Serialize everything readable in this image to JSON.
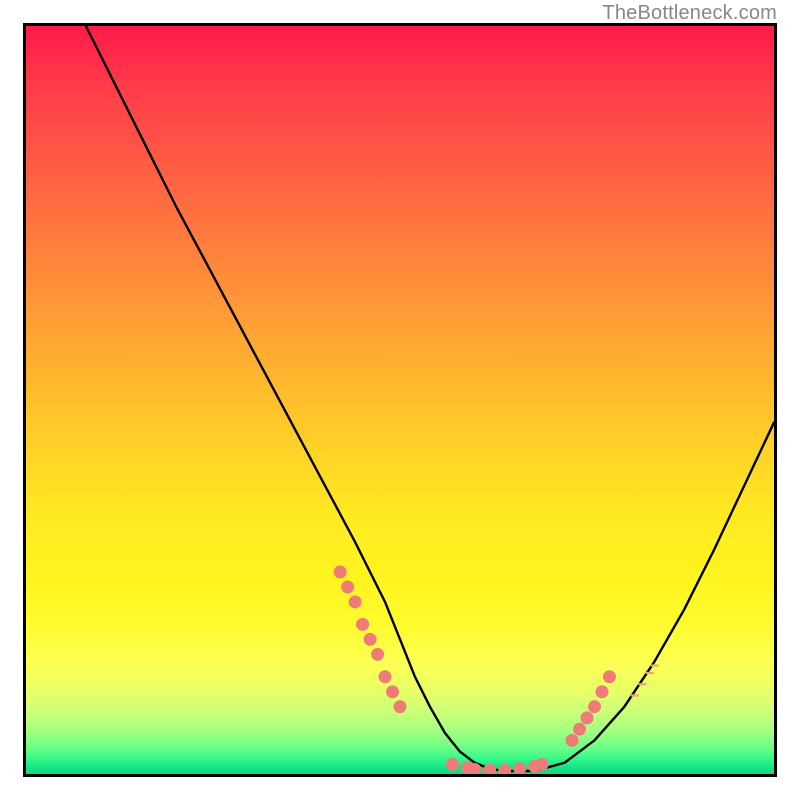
{
  "watermark": "TheBottleneck.com",
  "chart_data": {
    "type": "line",
    "title": "",
    "xlabel": "",
    "ylabel": "",
    "xlim": [
      0,
      100
    ],
    "ylim": [
      0,
      100
    ],
    "grid": false,
    "legend": false,
    "series": [
      {
        "name": "bottleneck-curve",
        "color": "#000000",
        "x": [
          8,
          12,
          16,
          20,
          24,
          28,
          32,
          36,
          40,
          44,
          48,
          50,
          52,
          54,
          56,
          58,
          60,
          62,
          64,
          68,
          72,
          76,
          80,
          84,
          88,
          92,
          96,
          100
        ],
        "y": [
          100,
          92,
          84,
          76,
          68.5,
          61,
          53.5,
          46,
          38.5,
          31,
          23,
          18,
          13,
          9,
          5.5,
          3,
          1.5,
          0.7,
          0.4,
          0.4,
          1.5,
          4.5,
          9,
          15,
          22,
          30,
          38.5,
          47
        ]
      }
    ],
    "marker_clusters": [
      {
        "name": "left-cluster-dots",
        "color": "#ee7b78",
        "points_approx": [
          [
            42,
            27
          ],
          [
            43,
            25
          ],
          [
            44,
            23
          ],
          [
            45,
            20
          ],
          [
            46,
            18
          ],
          [
            47,
            16
          ],
          [
            48,
            13
          ],
          [
            49,
            11
          ],
          [
            50,
            9
          ]
        ]
      },
      {
        "name": "bottom-cluster-dots",
        "color": "#ee7b78",
        "points_approx": [
          [
            57,
            1.3
          ],
          [
            59,
            0.8
          ],
          [
            60,
            0.6
          ],
          [
            62,
            0.5
          ],
          [
            64,
            0.5
          ],
          [
            66,
            0.7
          ],
          [
            68,
            1.0
          ],
          [
            69,
            1.3
          ]
        ]
      },
      {
        "name": "right-cluster-dots",
        "color": "#ee7b78",
        "points_approx": [
          [
            73,
            4.5
          ],
          [
            74,
            6
          ],
          [
            75,
            7.5
          ],
          [
            76,
            9
          ],
          [
            77,
            11
          ],
          [
            78,
            13
          ]
        ]
      }
    ],
    "right_tick_marks_approx_y": [
      10.5,
      12,
      13.5,
      14.5
    ]
  }
}
